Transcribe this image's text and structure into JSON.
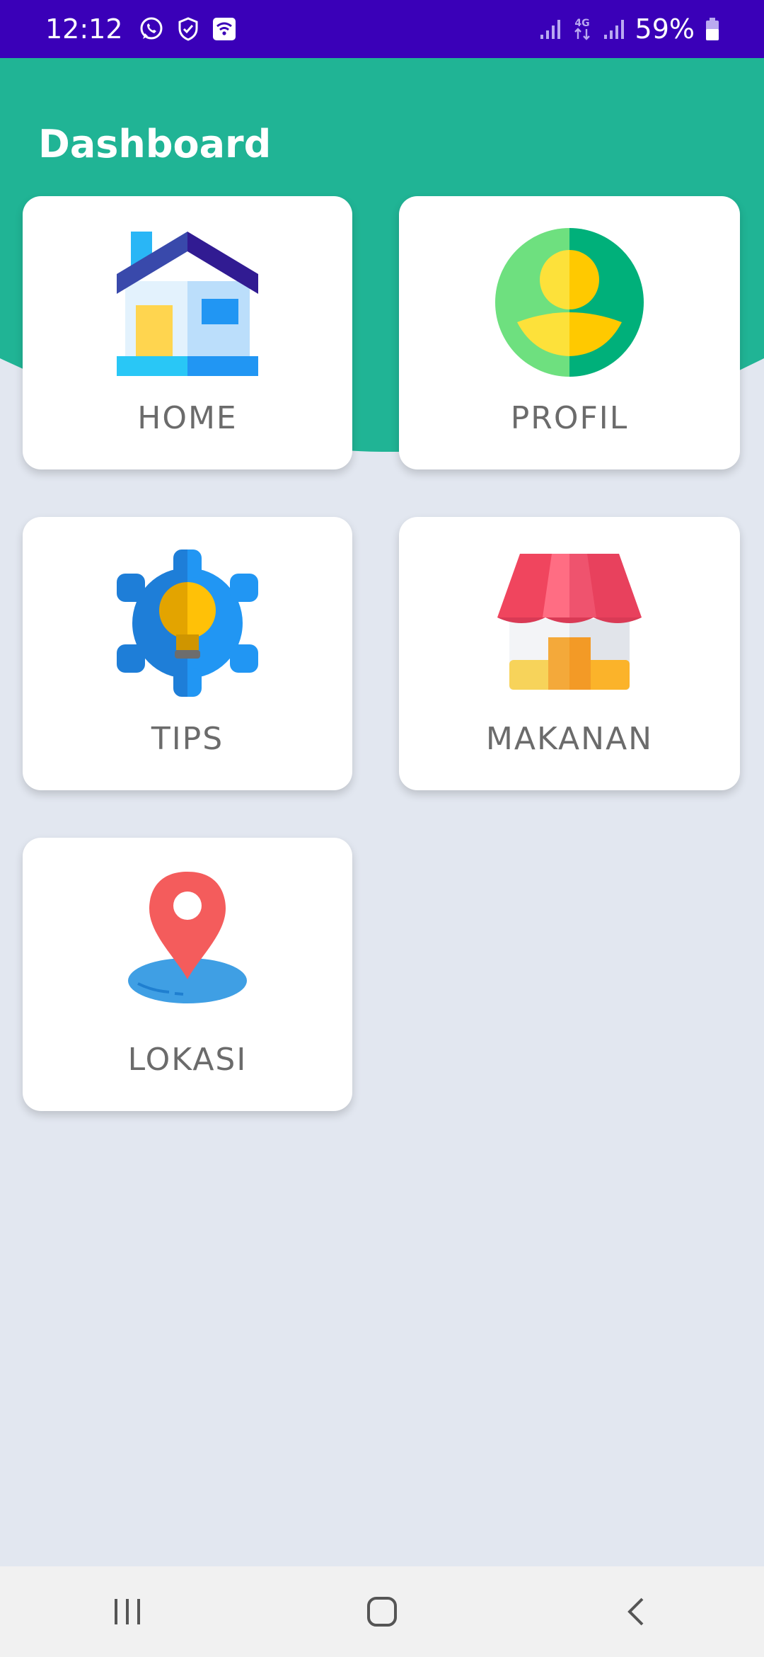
{
  "status_bar": {
    "time": "12:12",
    "network": "4G",
    "battery": "59%",
    "icons": [
      "whatsapp-icon",
      "shield-icon",
      "wifi-icon",
      "signal-icon",
      "4g-icon",
      "signal-icon",
      "battery-icon"
    ]
  },
  "header": {
    "title": "Dashboard"
  },
  "menu": [
    {
      "label": "HOME",
      "icon": "house-icon"
    },
    {
      "label": "PROFIL",
      "icon": "user-profile-icon"
    },
    {
      "label": "TIPS",
      "icon": "gear-lightbulb-icon"
    },
    {
      "label": "MAKANAN",
      "icon": "shop-icon"
    },
    {
      "label": "LOKASI",
      "icon": "location-pin-icon"
    }
  ],
  "nav_bar": {
    "buttons": [
      "recent-apps",
      "home",
      "back"
    ]
  },
  "colors": {
    "status_bar": "#3a00b8",
    "header": "#20b495",
    "background": "#e2e7f0",
    "card": "#ffffff",
    "label_text": "#6b6b6b"
  }
}
